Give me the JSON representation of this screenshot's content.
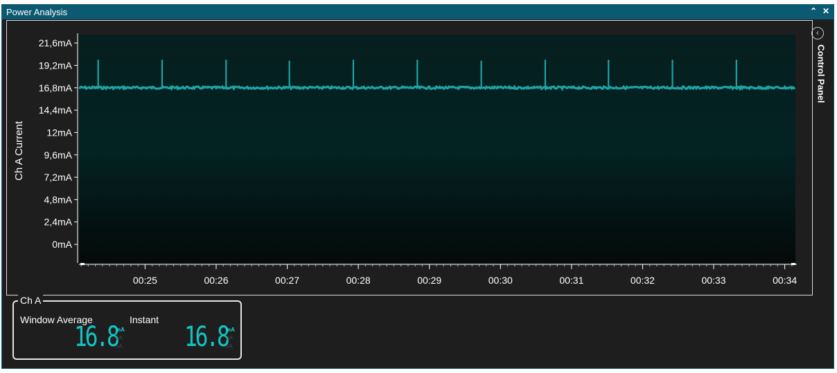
{
  "window": {
    "title": "Power Analysis",
    "collapse_icon": "chevron-up-icon",
    "close_icon": "close-icon"
  },
  "control_panel": {
    "label": "Control Panel",
    "toggle_icon": "chevron-left-icon"
  },
  "chart_data": {
    "type": "line",
    "ylabel": "Ch A Current",
    "y_ticks": [
      "21,6mA",
      "19,2mA",
      "16,8mA",
      "14,4mA",
      "12mA",
      "9,6mA",
      "7,2mA",
      "4,8mA",
      "2,4mA",
      "0mA"
    ],
    "y_tick_values": [
      21.6,
      19.2,
      16.8,
      14.4,
      12,
      9.6,
      7.2,
      4.8,
      2.4,
      0
    ],
    "ylim": [
      -2,
      22.5
    ],
    "x_ticks": [
      "00:25",
      "00:26",
      "00:27",
      "00:28",
      "00:29",
      "00:30",
      "00:31",
      "00:32",
      "00:33",
      "00:34"
    ],
    "x_tick_values": [
      25,
      26,
      27,
      28,
      29,
      30,
      31,
      32,
      33,
      34
    ],
    "xlim": [
      24.07,
      34.15
    ],
    "series": [
      {
        "color": "#1fa3a3",
        "baseline": 16.8,
        "spikes": [
          {
            "x": 24.34,
            "y": 19.8
          },
          {
            "x": 25.24,
            "y": 19.8
          },
          {
            "x": 26.14,
            "y": 19.8
          },
          {
            "x": 27.03,
            "y": 19.7
          },
          {
            "x": 27.93,
            "y": 19.8
          },
          {
            "x": 28.83,
            "y": 19.8
          },
          {
            "x": 29.73,
            "y": 19.7
          },
          {
            "x": 30.63,
            "y": 19.8
          },
          {
            "x": 31.52,
            "y": 19.8
          },
          {
            "x": 32.42,
            "y": 19.8
          },
          {
            "x": 33.32,
            "y": 19.8
          }
        ]
      }
    ]
  },
  "channel": {
    "legend": "Ch A",
    "window_average": {
      "label": "Window Average",
      "value": "16.8",
      "units": [
        "mA",
        "µA",
        "nA"
      ],
      "active_unit": "mA"
    },
    "instant": {
      "label": "Instant",
      "value": "16.8",
      "units": [
        "mA",
        "µA",
        "nA"
      ],
      "active_unit": "mA"
    }
  }
}
